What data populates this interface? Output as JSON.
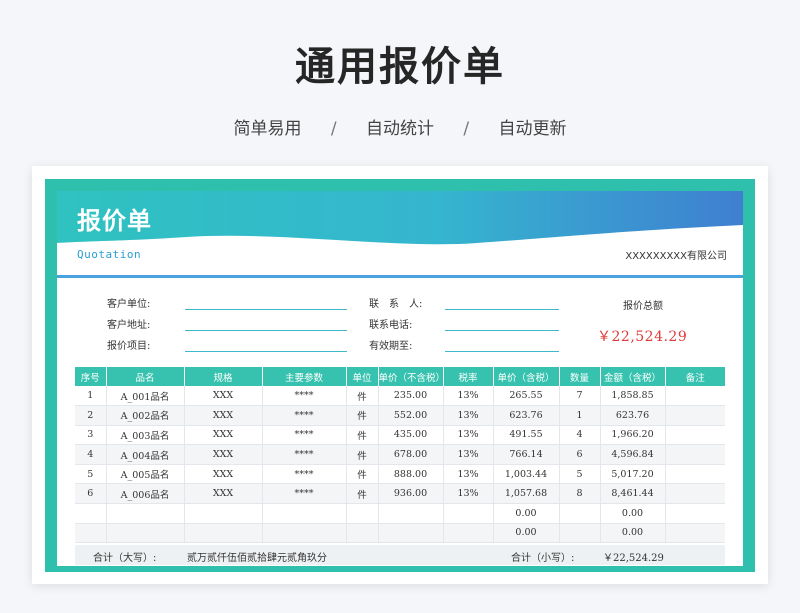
{
  "header": {
    "title": "通用报价单",
    "features": [
      "简单易用",
      "自动统计",
      "自动更新"
    ],
    "separator": "/"
  },
  "banner": {
    "title": "报价单",
    "subtitle": "Quotation",
    "company": "XXXXXXXXX有限公司"
  },
  "info": {
    "customer_unit_label": "客户单位:",
    "customer_address_label": "客户地址:",
    "quote_item_label": "报价项目:",
    "contact_label": "联　系　人:",
    "phone_label": "联系电话:",
    "valid_until_label": "有效期至:",
    "total_label": "报价总额",
    "total_value": "￥22,524.29"
  },
  "table": {
    "columns": [
      "序号",
      "品名",
      "规格",
      "主要参数",
      "单位",
      "单价（不含税）",
      "税率",
      "单价（含税）",
      "数量",
      "金额（含税）",
      "备注"
    ],
    "rows": [
      [
        "1",
        "A_001品名",
        "XXX",
        "****",
        "件",
        "235.00",
        "13%",
        "265.55",
        "7",
        "1,858.85",
        ""
      ],
      [
        "2",
        "A_002品名",
        "XXX",
        "****",
        "件",
        "552.00",
        "13%",
        "623.76",
        "1",
        "623.76",
        ""
      ],
      [
        "3",
        "A_003品名",
        "XXX",
        "****",
        "件",
        "435.00",
        "13%",
        "491.55",
        "4",
        "1,966.20",
        ""
      ],
      [
        "4",
        "A_004品名",
        "XXX",
        "****",
        "件",
        "678.00",
        "13%",
        "766.14",
        "6",
        "4,596.84",
        ""
      ],
      [
        "5",
        "A_005品名",
        "XXX",
        "****",
        "件",
        "888.00",
        "13%",
        "1,003.44",
        "5",
        "5,017.20",
        ""
      ],
      [
        "6",
        "A_006品名",
        "XXX",
        "****",
        "件",
        "936.00",
        "13%",
        "1,057.68",
        "8",
        "8,461.44",
        ""
      ],
      [
        "",
        "",
        "",
        "",
        "",
        "",
        "",
        "0.00",
        "",
        "0.00",
        ""
      ],
      [
        "",
        "",
        "",
        "",
        "",
        "",
        "",
        "0.00",
        "",
        "0.00",
        ""
      ]
    ]
  },
  "summary": {
    "upper_label": "合计（大写）:",
    "upper_value": "贰万贰仟伍佰贰拾肆元贰角玖分",
    "lower_label": "合计（小写）:",
    "lower_value": "￥22,524.29"
  },
  "colors": {
    "teal": "#2fbfad",
    "header_teal": "#36c2ae",
    "banner_start": "#2fc2c0",
    "banner_end": "#3f7fd0",
    "total_red": "#e03a3a"
  }
}
